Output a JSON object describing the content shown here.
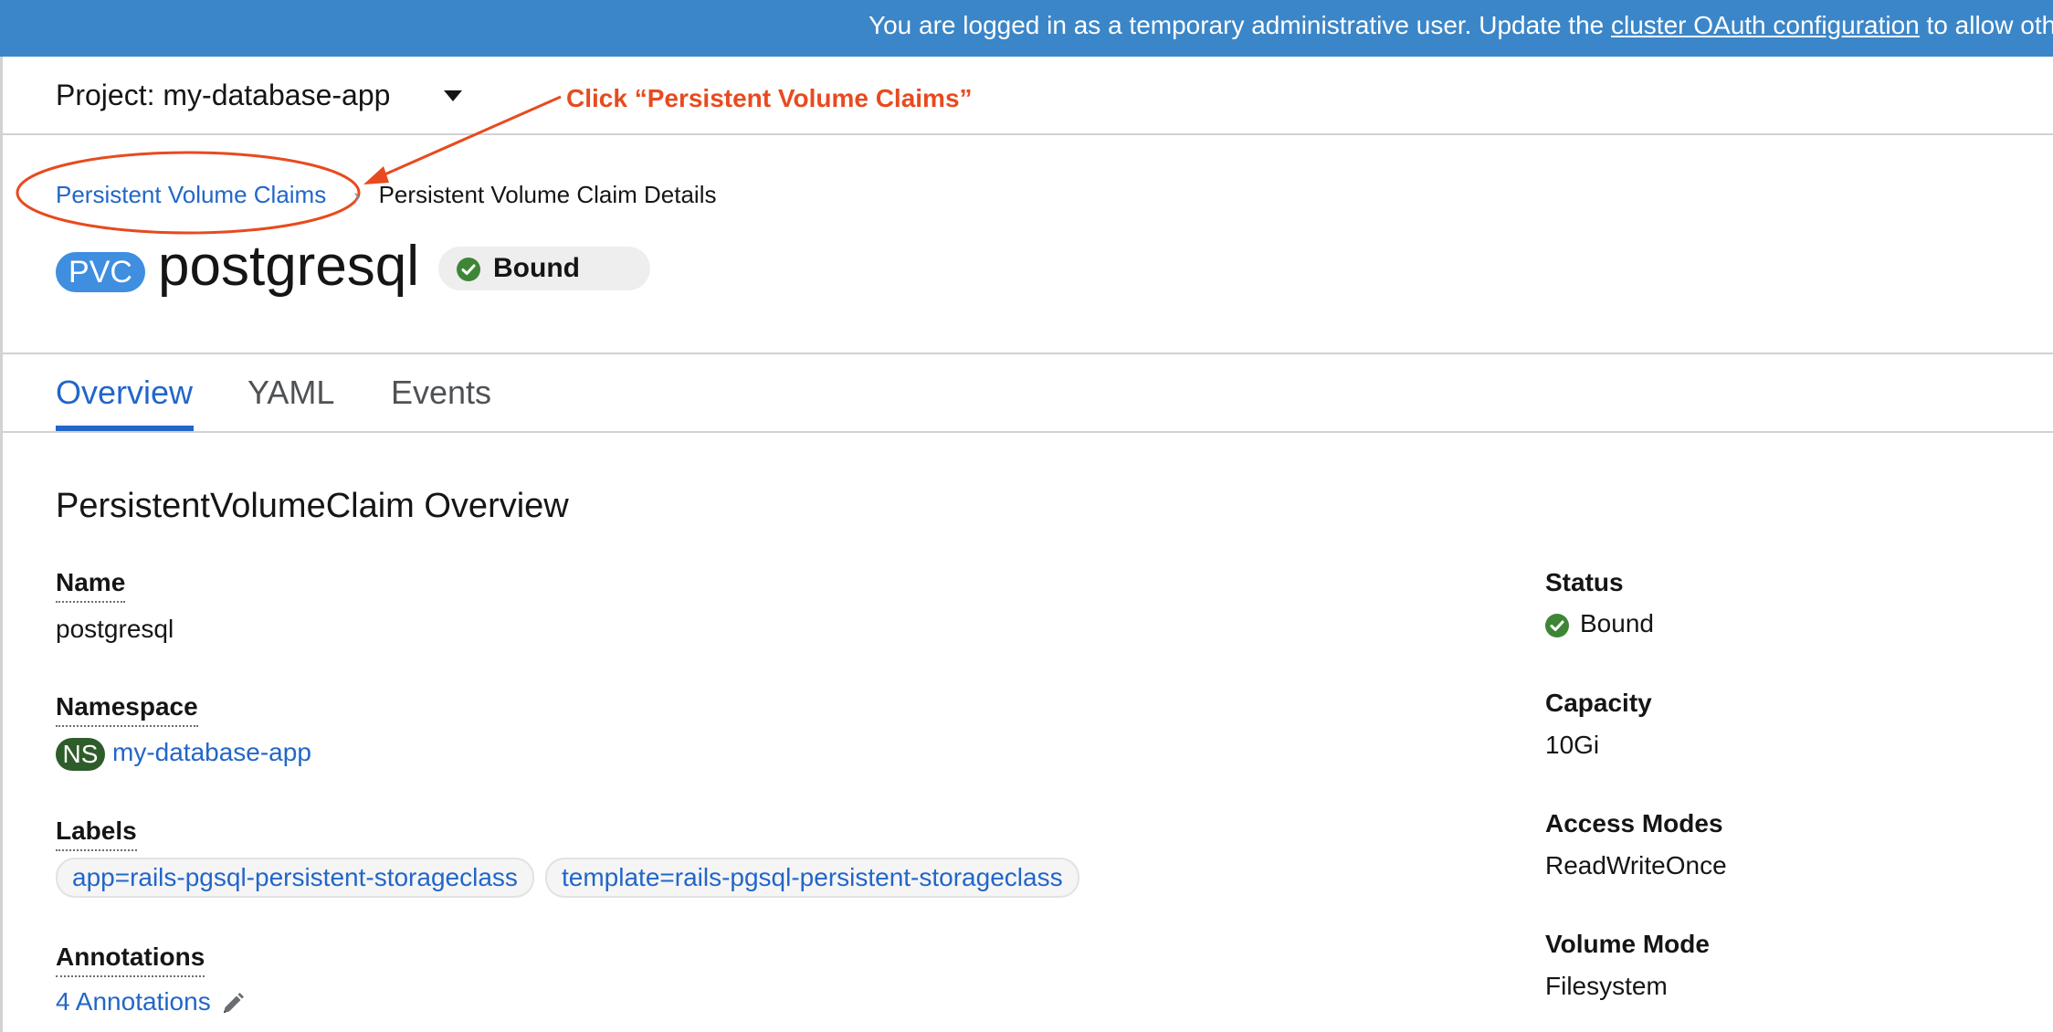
{
  "banner": {
    "text_before": "You are logged in as a temporary administrative user. Update the ",
    "link": "cluster OAuth configuration",
    "text_after": " to allow oth"
  },
  "project": {
    "label": "Project: my-database-app"
  },
  "annotation": {
    "text": "Click “Persistent Volume Claims”",
    "color": "#e84a1f"
  },
  "breadcrumb": {
    "parent": "Persistent Volume Claims",
    "separator": "›",
    "current": "Persistent Volume Claim Details"
  },
  "header": {
    "kind_badge": "PVC",
    "name": "postgresql",
    "status": "Bound"
  },
  "tabs": [
    {
      "label": "Overview",
      "active": true
    },
    {
      "label": "YAML",
      "active": false
    },
    {
      "label": "Events",
      "active": false
    }
  ],
  "overview": {
    "title": "PersistentVolumeClaim Overview",
    "left": {
      "name_label": "Name",
      "name_value": "postgresql",
      "namespace_label": "Namespace",
      "namespace_badge": "NS",
      "namespace_value": "my-database-app",
      "labels_label": "Labels",
      "labels": [
        "app=rails-pgsql-persistent-storageclass",
        "template=rails-pgsql-persistent-storageclass"
      ],
      "annotations_label": "Annotations",
      "annotations_value": "4 Annotations"
    },
    "right": {
      "status_label": "Status",
      "status_value": "Bound",
      "capacity_label": "Capacity",
      "capacity_value": "10Gi",
      "access_modes_label": "Access Modes",
      "access_modes_value": "ReadWriteOnce",
      "volume_mode_label": "Volume Mode",
      "volume_mode_value": "Filesystem"
    }
  },
  "colors": {
    "banner": "#3b86c8",
    "link": "#2266c8",
    "success": "#3e8635",
    "namespace_badge": "#2e5c2a"
  },
  "icons": [
    "caret-down-icon",
    "check-circle-icon",
    "pencil-icon",
    "chevron-right-icon"
  ]
}
